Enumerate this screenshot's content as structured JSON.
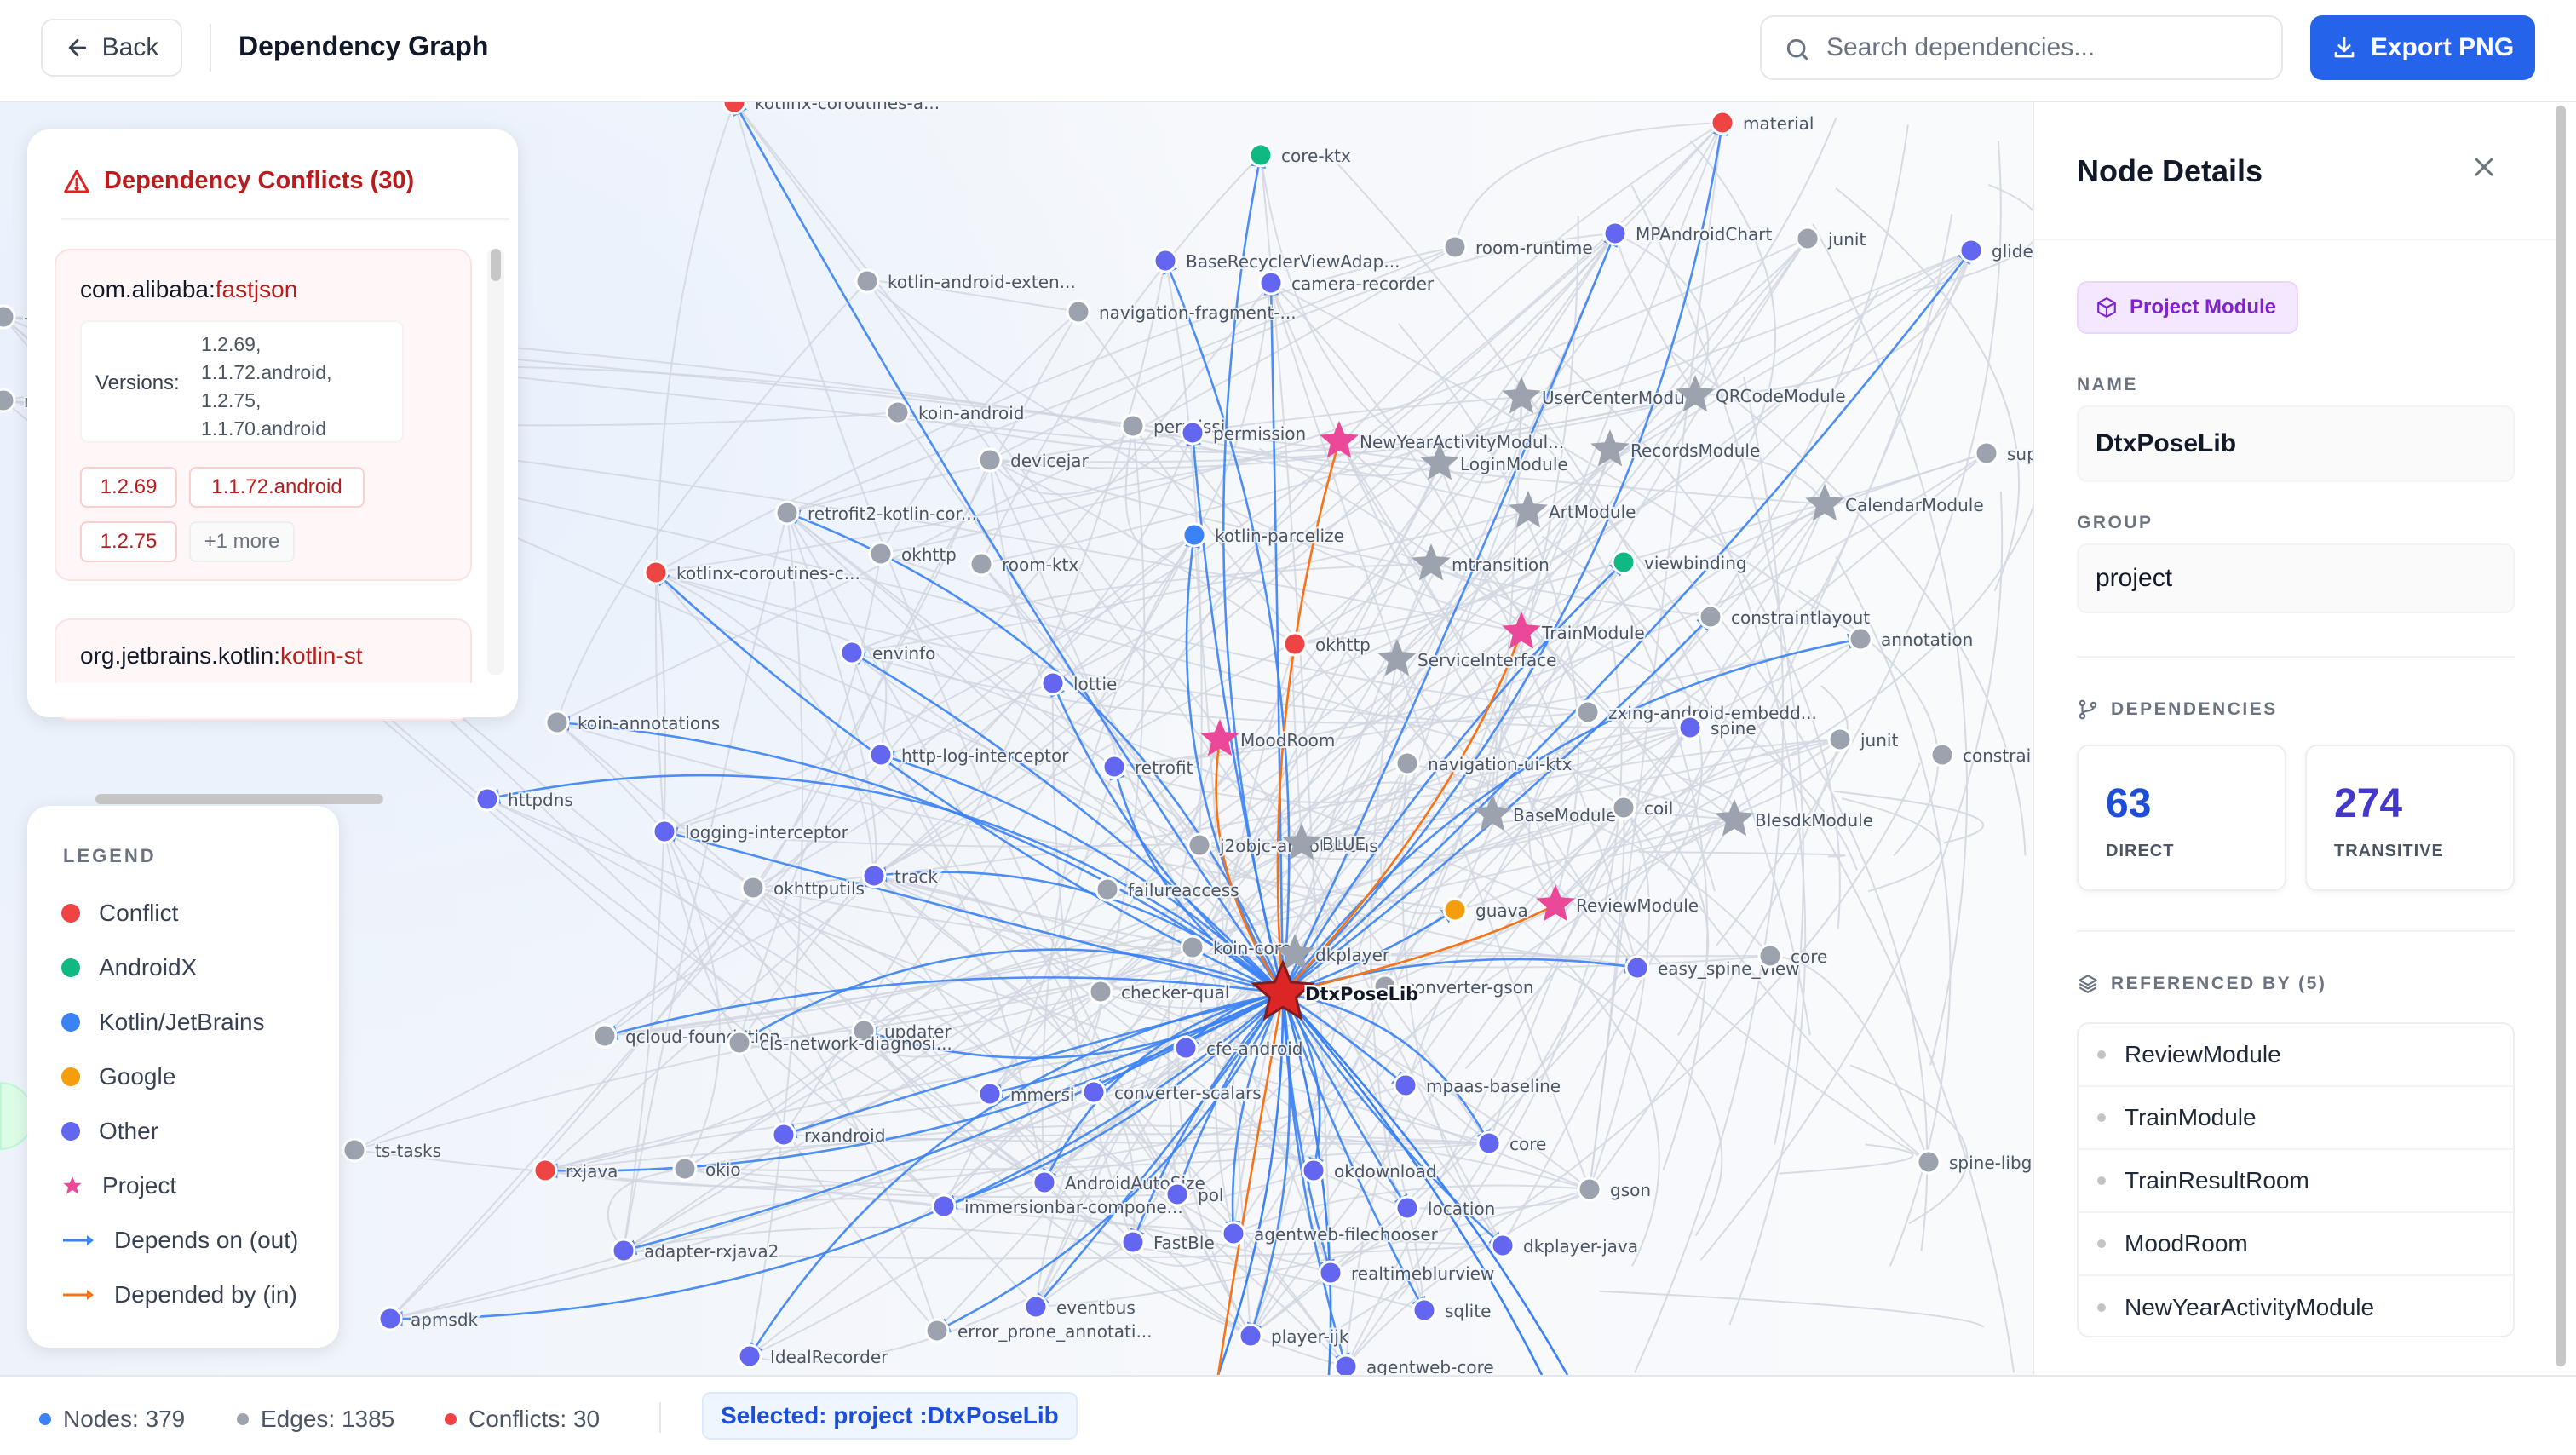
{
  "header": {
    "back_label": "Back",
    "title": "Dependency Graph",
    "search_placeholder": "Search dependencies...",
    "export_label": "Export PNG"
  },
  "conflicts": {
    "title": "Dependency Conflicts (30)",
    "items": [
      {
        "group": "com.alibaba:",
        "artifact": "fastjson",
        "versions_label": "Versions:",
        "versions": [
          "1.2.69,",
          "1.1.72.android,",
          "1.2.75,",
          "1.1.70.android"
        ],
        "chips": [
          "1.2.69",
          "1.1.72.android",
          "1.2.75"
        ],
        "more": "+1 more"
      },
      {
        "group": "org.jetbrains.kotlin:",
        "artifact": "kotlin-st"
      }
    ]
  },
  "legend": {
    "heading": "LEGEND",
    "items": [
      {
        "label": "Conflict",
        "color": "#ef4444"
      },
      {
        "label": "AndroidX",
        "color": "#10b981"
      },
      {
        "label": "Kotlin/JetBrains",
        "color": "#3b82f6"
      },
      {
        "label": "Google",
        "color": "#f59e0b"
      },
      {
        "label": "Other",
        "color": "#6366f1"
      },
      {
        "label": "Project",
        "color": "#ec4899"
      },
      {
        "label": "Depends on (out)",
        "color": "#3b82f6"
      },
      {
        "label": "Depended by (in)",
        "color": "#f97316"
      }
    ]
  },
  "graph": {
    "center_label": "DtxPoseLib",
    "nodes": [
      {
        "label": "kotlinx-coroutines-a...",
        "kind": "conflict"
      },
      {
        "label": "core-ktx",
        "kind": "androidx"
      },
      {
        "label": "material",
        "kind": "conflict"
      },
      {
        "label": "BaseRecyclerViewAdap...",
        "kind": "other"
      },
      {
        "label": "camera-recorder",
        "kind": "other"
      },
      {
        "label": "room-runtime",
        "kind": "gray"
      },
      {
        "label": "MPAndroidChart",
        "kind": "other"
      },
      {
        "label": "junit",
        "kind": "gray"
      },
      {
        "label": "glide",
        "kind": "other"
      },
      {
        "label": "kotlin-android-exten...",
        "kind": "gray"
      },
      {
        "label": "navigation-fragment-...",
        "kind": "gray"
      },
      {
        "label": "koin-android",
        "kind": "gray"
      },
      {
        "label": "permissi",
        "kind": "gray"
      },
      {
        "label": "permission",
        "kind": "other"
      },
      {
        "label": "NewYearActivityModul...",
        "kind": "project"
      },
      {
        "label": "UserCenterModu",
        "kind": "module"
      },
      {
        "label": "QRCodeModule",
        "kind": "module"
      },
      {
        "label": "devicejar",
        "kind": "gray"
      },
      {
        "label": "LoginModule",
        "kind": "module"
      },
      {
        "label": "RecordsModule",
        "kind": "module"
      },
      {
        "label": "sup",
        "kind": "gray"
      },
      {
        "label": "retrofit2-kotlin-cor...",
        "kind": "gray"
      },
      {
        "label": "okhttp",
        "kind": "gray"
      },
      {
        "label": "room-ktx",
        "kind": "gray"
      },
      {
        "label": "kotlin-parcelize",
        "kind": "kotlin"
      },
      {
        "label": "ArtModule",
        "kind": "module"
      },
      {
        "label": "CalendarModule",
        "kind": "module"
      },
      {
        "label": "kotlinx-coroutines-c...",
        "kind": "conflict"
      },
      {
        "label": "mtransition",
        "kind": "module"
      },
      {
        "label": "viewbinding",
        "kind": "androidx"
      },
      {
        "label": "TrainModule",
        "kind": "project"
      },
      {
        "label": "constraintlayout",
        "kind": "gray"
      },
      {
        "label": "annotation",
        "kind": "gray"
      },
      {
        "label": "envinfo",
        "kind": "other"
      },
      {
        "label": "okhttp",
        "kind": "conflict"
      },
      {
        "label": "ServiceInterface",
        "kind": "module"
      },
      {
        "label": "lottie",
        "kind": "other"
      },
      {
        "label": "koin-annotations",
        "kind": "gray"
      },
      {
        "label": "zxing-android-embedd...",
        "kind": "gray"
      },
      {
        "label": "spine",
        "kind": "other"
      },
      {
        "label": "junit",
        "kind": "gray"
      },
      {
        "label": "constrai",
        "kind": "gray"
      },
      {
        "label": "MoodRoom",
        "kind": "project"
      },
      {
        "label": "http-log-interceptor",
        "kind": "other"
      },
      {
        "label": "retrofit",
        "kind": "other"
      },
      {
        "label": "navigation-ui-ktx",
        "kind": "gray"
      },
      {
        "label": "httpdns",
        "kind": "other"
      },
      {
        "label": "BaseModule",
        "kind": "module"
      },
      {
        "label": "coil",
        "kind": "gray"
      },
      {
        "label": "BlesdkModule",
        "kind": "module"
      },
      {
        "label": "logging-interceptor",
        "kind": "other"
      },
      {
        "label": "j2objc-annotations",
        "kind": "gray"
      },
      {
        "label": "track",
        "kind": "other"
      },
      {
        "label": "okhttputils",
        "kind": "gray"
      },
      {
        "label": "failureaccess",
        "kind": "gray"
      },
      {
        "label": "guava",
        "kind": "google"
      },
      {
        "label": "ReviewModule",
        "kind": "project"
      },
      {
        "label": "koin-core",
        "kind": "gray"
      },
      {
        "label": "easy_spine_view",
        "kind": "other"
      },
      {
        "label": "core",
        "kind": "gray"
      },
      {
        "label": "checker-qual",
        "kind": "gray"
      },
      {
        "label": "converter-gson",
        "kind": "gray"
      },
      {
        "label": "qcloud-foundation",
        "kind": "gray"
      },
      {
        "label": "updater",
        "kind": "gray"
      },
      {
        "label": "cls-network-diagnosi...",
        "kind": "gray"
      },
      {
        "label": "rxandroid",
        "kind": "other"
      },
      {
        "label": "mmersi",
        "kind": "other"
      },
      {
        "label": "converter-scalars",
        "kind": "other"
      },
      {
        "label": "mpaas-baseline",
        "kind": "other"
      },
      {
        "label": "ts-tasks",
        "kind": "gray"
      },
      {
        "label": "core",
        "kind": "other"
      },
      {
        "label": "gson",
        "kind": "gray"
      },
      {
        "label": "spine-libg",
        "kind": "gray"
      },
      {
        "label": "rxjava",
        "kind": "conflict"
      },
      {
        "label": "okio",
        "kind": "gray"
      },
      {
        "label": "AndroidAutoSize",
        "kind": "other"
      },
      {
        "label": "immersionbar-compone...",
        "kind": "other"
      },
      {
        "label": "okdownload",
        "kind": "other"
      },
      {
        "label": "location",
        "kind": "other"
      },
      {
        "label": "adapter-rxjava2",
        "kind": "other"
      },
      {
        "label": "FastBle",
        "kind": "other"
      },
      {
        "label": "agentweb-filechooser",
        "kind": "other"
      },
      {
        "label": "dkplayer-java",
        "kind": "other"
      },
      {
        "label": "realtimeblurview",
        "kind": "other"
      },
      {
        "label": "apmsdk",
        "kind": "other"
      },
      {
        "label": "eventbus",
        "kind": "other"
      },
      {
        "label": "sqlite",
        "kind": "other"
      },
      {
        "label": "error_prone_annotati...",
        "kind": "gray"
      },
      {
        "label": "player-ijk",
        "kind": "other"
      },
      {
        "label": "IdealRecorder",
        "kind": "other"
      },
      {
        "label": "agentweb-core",
        "kind": "other"
      },
      {
        "label": "pol",
        "kind": "other"
      },
      {
        "label": "cfe-android",
        "kind": "other"
      },
      {
        "label": "BLUE",
        "kind": "module"
      },
      {
        "label": "dkplayer",
        "kind": "module"
      },
      {
        "label": "-jd",
        "kind": "gray"
      },
      {
        "label": "nx-c",
        "kind": "gray"
      }
    ]
  },
  "panel": {
    "title": "Node Details",
    "type_badge": "Project Module",
    "name_label": "NAME",
    "name_value": "DtxPoseLib",
    "group_label": "GROUP",
    "group_value": "project",
    "deps_label": "DEPENDENCIES",
    "direct": "63",
    "direct_label": "DIRECT",
    "transitive": "274",
    "transitive_label": "TRANSITIVE",
    "ref_label": "REFERENCED BY (5)",
    "refs": [
      "ReviewModule",
      "TrainModule",
      "TrainResultRoom",
      "MoodRoom",
      "NewYearActivityModule"
    ]
  },
  "status": {
    "nodes": "Nodes: 379",
    "edges": "Edges: 1385",
    "conflicts": "Conflicts: 30",
    "selected": "Selected: project :DtxPoseLib"
  },
  "colors": {
    "conflict": "#ef4444",
    "androidx": "#10b981",
    "kotlin": "#3b82f6",
    "google": "#f59e0b",
    "other": "#6366f1",
    "project": "#ec4899",
    "module": "#9ca3af",
    "gray": "#9ca3af",
    "edge_out": "#3b82f6",
    "edge_in": "#f97316",
    "accent": "#2563eb"
  }
}
